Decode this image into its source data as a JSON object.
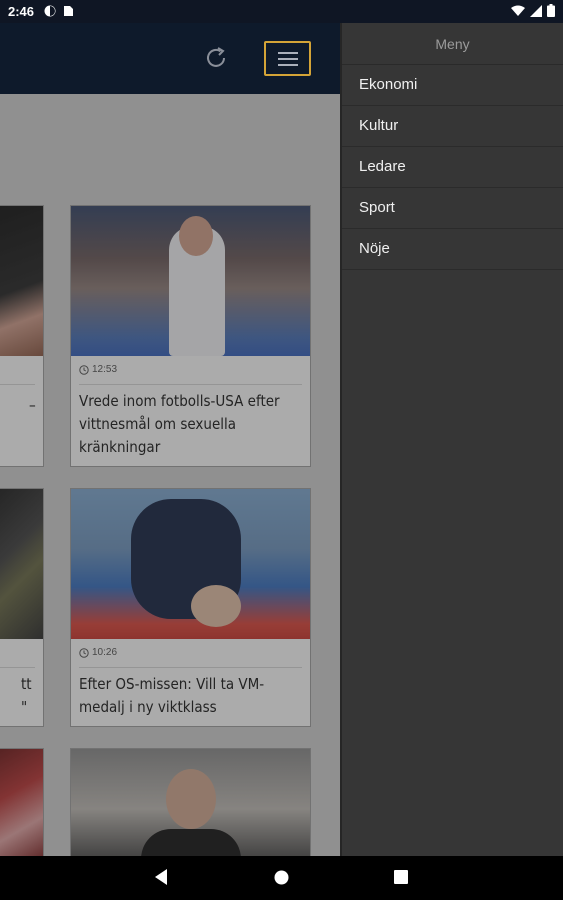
{
  "status_bar": {
    "time": "2:46"
  },
  "app": {
    "cards": [
      {
        "time": "12:53",
        "headline": "Vrede inom fotbolls-USA efter vittnesmål om sexuella kränkningar"
      },
      {
        "time": "10:26",
        "headline": "Efter OS-missen: Vill ta VM-medalj i ny viktklass"
      },
      {
        "time": "",
        "headline": ""
      }
    ],
    "partial_cards": [
      {
        "fragment": "–"
      },
      {
        "fragment": "tt\n\""
      }
    ]
  },
  "drawer": {
    "title": "Meny",
    "items": [
      "Ekonomi",
      "Kultur",
      "Ledare",
      "Sport",
      "Nöje"
    ]
  },
  "colors": {
    "appbar": "#0e1a2b",
    "drawer": "#363636",
    "accent": "#d4a437"
  }
}
